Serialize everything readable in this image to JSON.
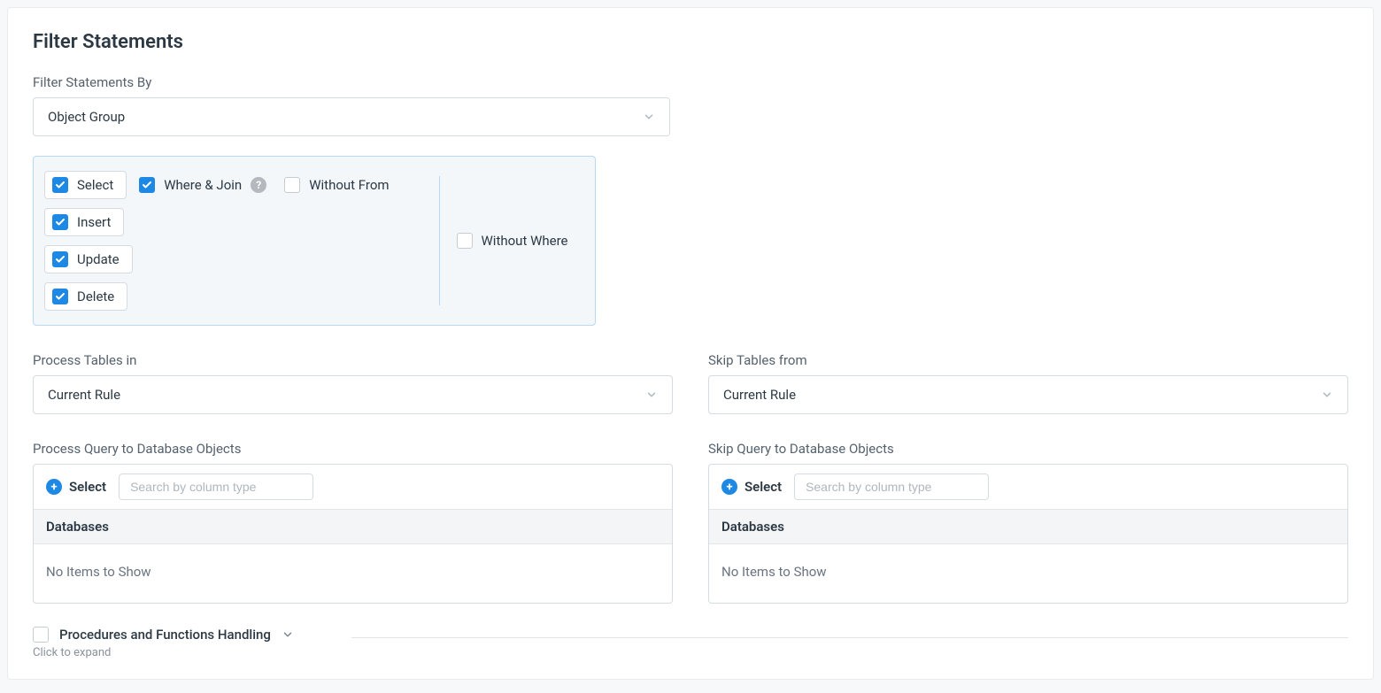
{
  "title": "Filter Statements",
  "filterBy": {
    "label": "Filter Statements By",
    "value": "Object Group"
  },
  "statementTypes": {
    "select": {
      "label": "Select",
      "checked": true
    },
    "whereJoin": {
      "label": "Where & Join",
      "checked": true
    },
    "withoutFrom": {
      "label": "Without From",
      "checked": false
    },
    "insert": {
      "label": "Insert",
      "checked": true
    },
    "update": {
      "label": "Update",
      "checked": true
    },
    "delete": {
      "label": "Delete",
      "checked": true
    },
    "withoutWhere": {
      "label": "Without Where",
      "checked": false
    }
  },
  "process": {
    "tablesLabel": "Process Tables in",
    "tablesValue": "Current Rule",
    "queryLabel": "Process Query to Database Objects",
    "selectLabel": "Select",
    "searchPlaceholder": "Search by column type",
    "tableHeader": "Databases",
    "emptyText": "No Items to Show"
  },
  "skip": {
    "tablesLabel": "Skip Tables from",
    "tablesValue": "Current Rule",
    "queryLabel": "Skip Query to Database Objects",
    "selectLabel": "Select",
    "searchPlaceholder": "Search by column type",
    "tableHeader": "Databases",
    "emptyText": "No Items to Show"
  },
  "expander": {
    "title": "Procedures and Functions Handling",
    "hint": "Click to expand"
  }
}
